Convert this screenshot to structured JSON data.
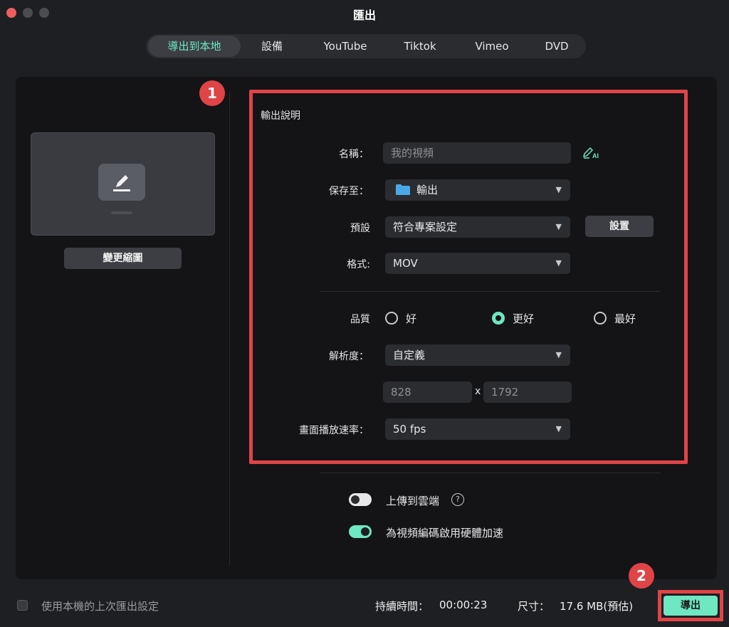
{
  "window": {
    "title": "匯出"
  },
  "tabs": [
    {
      "label": "導出到本地",
      "active": true
    },
    {
      "label": "設備"
    },
    {
      "label": "YouTube"
    },
    {
      "label": "Tiktok"
    },
    {
      "label": "Vimeo"
    },
    {
      "label": "DVD"
    }
  ],
  "thumbnail": {
    "change_label": "變更縮圖"
  },
  "annotations": {
    "badge1": "1",
    "badge2": "2"
  },
  "output": {
    "section_title": "輸出說明",
    "name_label": "名稱：",
    "name_value": "我的視頻",
    "ai_label": "AI",
    "save_label": "保存至：",
    "save_value": "輸出",
    "preset_label": "預設",
    "preset_value": "符合專案設定",
    "settings_button": "設置",
    "format_label": "格式:",
    "format_value": "MOV",
    "quality_label": "品質",
    "quality_options": [
      "好",
      "更好",
      "最好"
    ],
    "quality_selected": "更好",
    "resolution_label": "解析度：",
    "resolution_value": "自定義",
    "width": "828",
    "times": "x",
    "height": "1792",
    "fps_label": "畫面播放速率：",
    "fps_value": "50 fps"
  },
  "toggles": {
    "upload_label": "上傳到雲端",
    "upload_on": false,
    "help": "?",
    "hw_label": "為視頻編碼啟用硬體加速",
    "hw_on": true
  },
  "footer": {
    "remember_label": "使用本機的上次匯出設定",
    "duration_label": "持續時間：",
    "duration_value": "00:00:23",
    "size_label": "尺寸：",
    "size_value": "17.6 MB(預估)",
    "export_button": "導出"
  },
  "colors": {
    "accent": "#6ee7c2",
    "annotation": "#e04447",
    "panel": "#141416"
  }
}
